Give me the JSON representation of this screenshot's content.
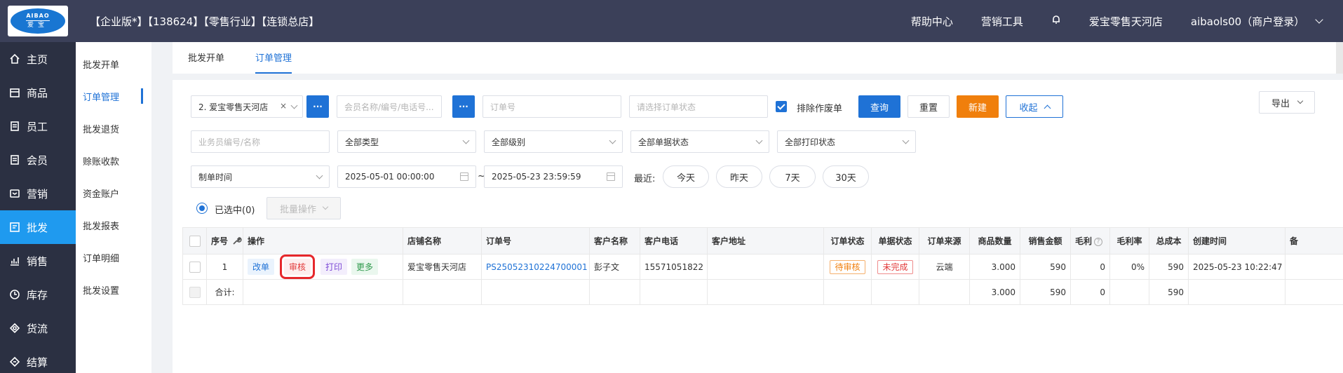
{
  "logo": {
    "top": "AIBAO",
    "bottom": "爱宝"
  },
  "nav": [
    {
      "label": "主页",
      "icon": "home-icon"
    },
    {
      "label": "商品",
      "icon": "goods-icon"
    },
    {
      "label": "员工",
      "icon": "staff-icon"
    },
    {
      "label": "会员",
      "icon": "member-icon"
    },
    {
      "label": "营销",
      "icon": "marketing-icon"
    },
    {
      "label": "批发",
      "icon": "wholesale-icon"
    },
    {
      "label": "销售",
      "icon": "sales-chart-icon"
    },
    {
      "label": "库存",
      "icon": "inventory-icon"
    },
    {
      "label": "货流",
      "icon": "goods-flow-icon"
    },
    {
      "label": "结算",
      "icon": "settlement-icon"
    }
  ],
  "header": {
    "title": "【企业版*】【138624】【零售行业】【连锁总店】",
    "help": "帮助中心",
    "tools": "营销工具",
    "store": "爱宝零售天河店",
    "user": "aibaols00（商户登录）"
  },
  "subnav": [
    "批发开单",
    "订单管理",
    "批发退货",
    "赊账收款",
    "资金账户",
    "批发报表",
    "订单明细",
    "批发设置"
  ],
  "tabs": [
    "批发开单",
    "订单管理"
  ],
  "filters": {
    "store": "2. 爱宝零售天河店",
    "member_ph": "会员名称/编号/电话号...",
    "order_no_ph": "订单号",
    "order_status_ph": "请选择订单状态",
    "exclude_void": "排除作废单",
    "query": "查询",
    "reset": "重置",
    "create": "新建",
    "collapse": "收起",
    "export": "导出",
    "salesman_ph": "业务员编号/名称",
    "type": "全部类型",
    "level": "全部级别",
    "doc_status": "全部单据状态",
    "print_status": "全部打印状态",
    "time_type": "制单时间",
    "date_from": "2025-05-01 00:00:00",
    "date_sep": "~",
    "date_to": "2025-05-23 23:59:59",
    "recent": "最近:",
    "today": "今天",
    "yesterday": "昨天",
    "d7": "7天",
    "d30": "30天",
    "selected": "已选中(0)",
    "batch": "批量操作"
  },
  "table": {
    "headers": [
      "序号",
      "操作",
      "店铺名称",
      "订单号",
      "客户名称",
      "客户电话",
      "客户地址",
      "订单状态",
      "单据状态",
      "订单来源",
      "商品数量",
      "销售金额",
      "毛利",
      "毛利率",
      "总成本",
      "创建时间",
      "备"
    ],
    "ops": [
      "改单",
      "审核",
      "打印",
      "更多"
    ],
    "row": {
      "no": "1",
      "store": "爱宝零售天河店",
      "order_no": "PS25052310224700001",
      "customer": "彭子文",
      "phone": "15571051822",
      "address": "",
      "order_status": "待审核",
      "doc_status": "未完成",
      "source": "云端",
      "qty": "3.000",
      "amount": "590",
      "profit": "0",
      "profit_rate": "0%",
      "cost": "590",
      "created": "2025-05-23 10:22:47"
    },
    "total": {
      "label": "合计:",
      "qty": "3.000",
      "amount": "590",
      "profit": "0",
      "cost": "590"
    }
  }
}
